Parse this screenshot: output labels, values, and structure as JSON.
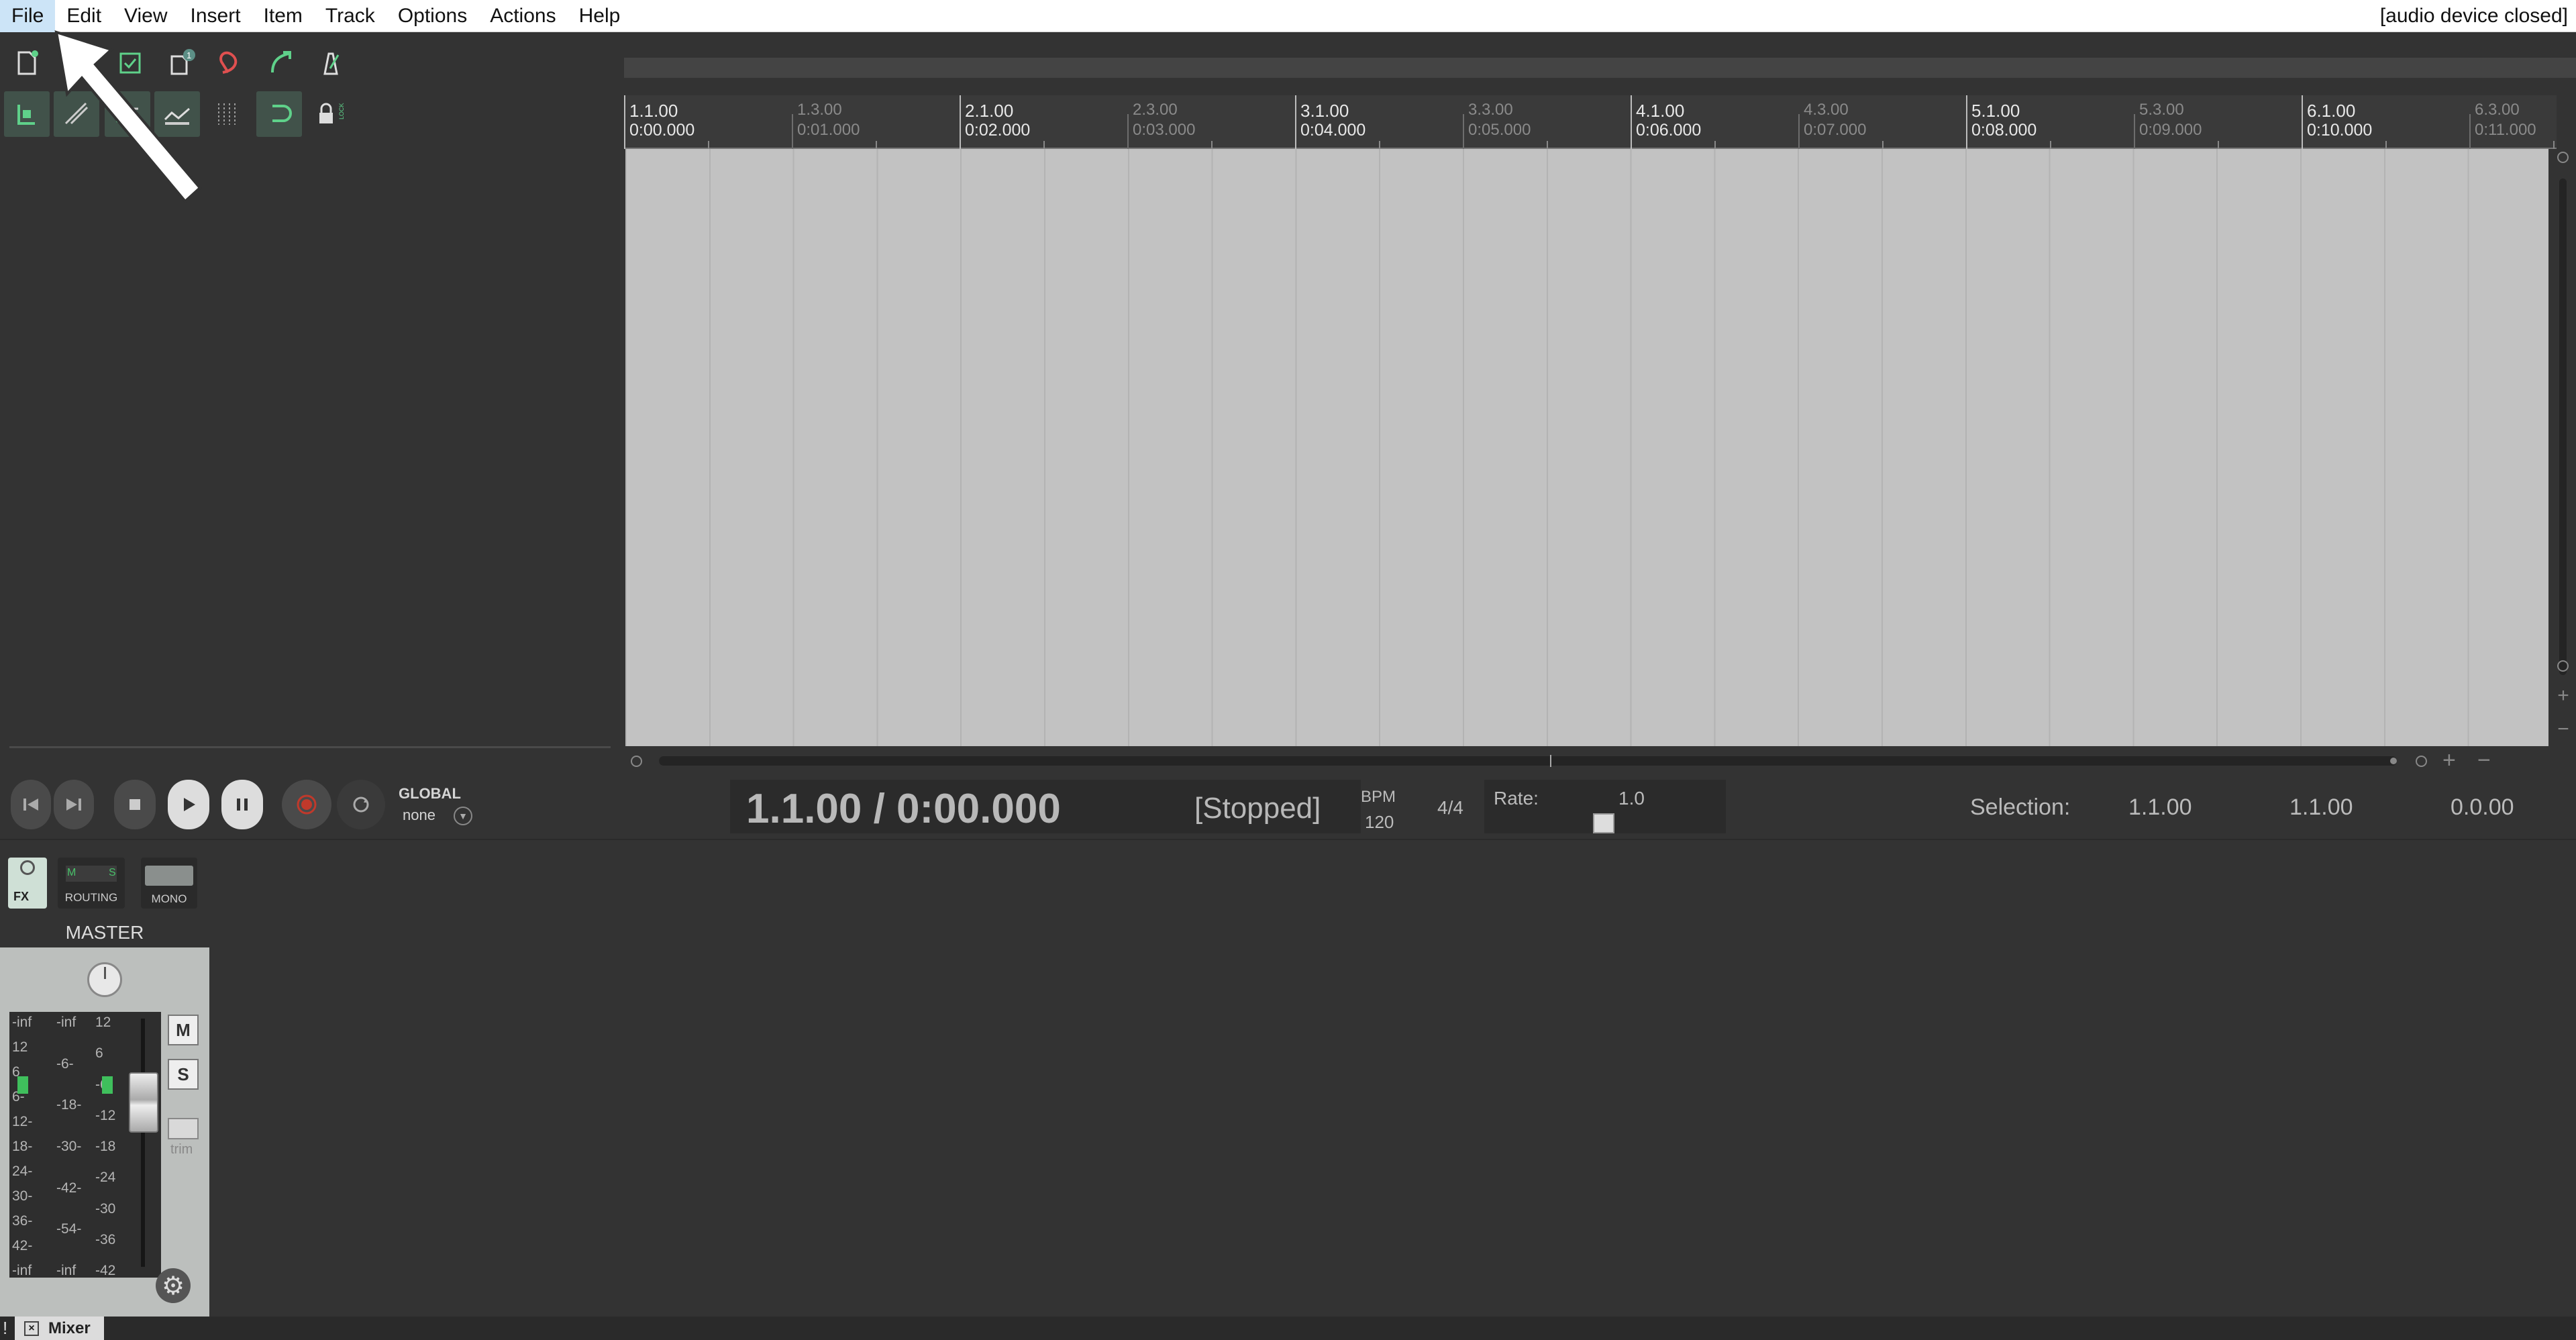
{
  "menu": {
    "items": [
      "File",
      "Edit",
      "View",
      "Insert",
      "Item",
      "Track",
      "Options",
      "Actions",
      "Help"
    ],
    "device_status": "[audio device closed]"
  },
  "ruler": {
    "major": [
      {
        "bar": "1.1.00",
        "time": "0:00.000"
      },
      {
        "bar": "2.1.00",
        "time": "0:02.000"
      },
      {
        "bar": "3.1.00",
        "time": "0:04.000"
      },
      {
        "bar": "4.1.00",
        "time": "0:06.000"
      },
      {
        "bar": "5.1.00",
        "time": "0:08.000"
      },
      {
        "bar": "6.1.00",
        "time": "0:10.000"
      }
    ],
    "minor": [
      {
        "bar": "1.3.00",
        "time": "0:01.000"
      },
      {
        "bar": "2.3.00",
        "time": "0:03.000"
      },
      {
        "bar": "3.3.00",
        "time": "0:05.000"
      },
      {
        "bar": "4.3.00",
        "time": "0:07.000"
      },
      {
        "bar": "5.3.00",
        "time": "0:09.000"
      },
      {
        "bar": "6.3.00",
        "time": "0:11.000"
      }
    ]
  },
  "toolbar": {
    "icons": [
      "new-project-icon",
      "open-project-icon",
      "save-project-icon",
      "project-settings-icon",
      "undo-icon",
      "redo-icon",
      "metronome-icon",
      "snap-icon",
      "ripple-edit-icon",
      "auto-crossfade-icon",
      "envelope-icon",
      "grid-icon",
      "loop-icon",
      "lock-icon"
    ],
    "badge": "1",
    "lock_side_label": "LOCK"
  },
  "transport": {
    "global_label": "GLOBAL",
    "automation_mode": "none",
    "time_display": "1.1.00 / 0:00.000",
    "state": "[Stopped]",
    "bpm_label": "BPM",
    "bpm_value": "120",
    "time_signature": "4/4",
    "rate_label": "Rate:",
    "rate_value": "1.0",
    "selection_label": "Selection:",
    "selection_start": "1.1.00",
    "selection_end": "1.1.00",
    "selection_length": "0.0.00"
  },
  "master": {
    "fx_label": "FX",
    "routing_label": "ROUTING",
    "routing_m": "M",
    "routing_s": "S",
    "mono_label": "MONO",
    "title": "MASTER",
    "mute_label": "M",
    "solo_label": "S",
    "trim_label": "trim",
    "meter_scale_left": [
      "-inf",
      "12",
      "6",
      "6-",
      "12-",
      "18-",
      "24-",
      "30-",
      "36-",
      "42-",
      "-inf"
    ],
    "meter_scale_mid": [
      "-inf",
      "-6-",
      "-18-",
      "-30-",
      "-42-",
      "-54-",
      "-inf"
    ],
    "meter_scale_right": [
      "12",
      "6",
      "-6",
      "-12",
      "-18",
      "-24",
      "-30",
      "-36",
      "-42"
    ]
  },
  "bottom": {
    "excl": "!",
    "tab_label": "Mixer"
  },
  "colors": {
    "menu_active": "#cce4f7",
    "arrange_bg": "#c2c2c2",
    "record_red": "#c0392b",
    "toolbar_green": "#5fd18a",
    "toolbar_red": "#e05050"
  }
}
